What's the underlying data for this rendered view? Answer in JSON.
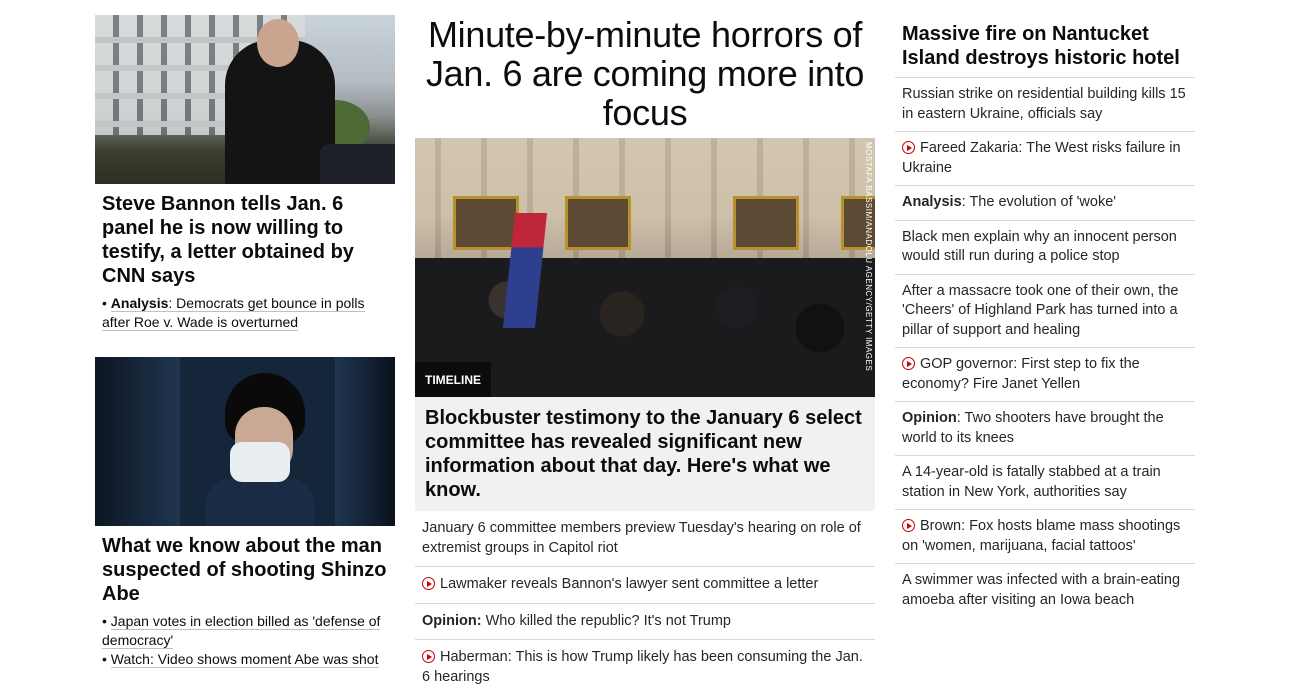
{
  "left": {
    "story1": {
      "headline": "Steve Bannon tells Jan. 6 panel he is now willing to testify, a letter obtained by CNN says",
      "links": [
        {
          "prefix": "Analysis",
          "text": ": Democrats get bounce in polls after Roe v. Wade is overturned"
        }
      ]
    },
    "story2": {
      "headline": "What we know about the man suspected of shooting Shinzo Abe",
      "links": [
        {
          "text": "Japan votes in election billed as 'defense of democracy'"
        },
        {
          "text": "Watch: Video shows moment Abe was shot"
        }
      ]
    }
  },
  "center": {
    "title": "Minute-by-minute horrors of Jan. 6 are coming more into focus",
    "photo_credit": "MOSTAFA BASSIM/ANADOLU AGENCY/GETTY IMAGES",
    "badge": "TIMELINE",
    "hero_text": "Blockbuster testimony to the January 6 select committee has revealed significant new information about that day. Here's what we know.",
    "items": [
      {
        "text": "January 6 committee members preview Tuesday's hearing on role of extremist groups in Capitol riot"
      },
      {
        "video": true,
        "text": "Lawmaker reveals Bannon's lawyer sent committee a letter"
      },
      {
        "prefix": "Opinion:",
        "text": " Who killed the republic? It's not Trump"
      },
      {
        "video": true,
        "text": "Haberman: This is how Trump likely has been consuming the Jan. 6 hearings"
      }
    ]
  },
  "right": {
    "headline": "Massive fire on Nantucket Island destroys historic hotel",
    "items": [
      {
        "text": "Russian strike on residential building kills 15 in eastern Ukraine, officials say"
      },
      {
        "video": true,
        "text": "Fareed Zakaria: The West risks failure in Ukraine"
      },
      {
        "prefix": "Analysis",
        "text": ": The evolution of 'woke'"
      },
      {
        "text": "Black men explain why an innocent person would still run during a police stop"
      },
      {
        "text": "After a massacre took one of their own, the 'Cheers' of Highland Park has turned into a pillar of support and healing"
      },
      {
        "video": true,
        "text": "GOP governor: First step to fix the economy? Fire Janet Yellen"
      },
      {
        "prefix": "Opinion",
        "text": ": Two shooters have brought the world to its knees"
      },
      {
        "text": "A 14-year-old is fatally stabbed at a train station in New York, authorities say"
      },
      {
        "video": true,
        "text": "Brown: Fox hosts blame mass shootings on 'women, marijuana, facial tattoos'"
      },
      {
        "text": "A swimmer was infected with a brain-eating amoeba after visiting an Iowa beach"
      }
    ]
  },
  "colors": {
    "accent_red": "#cc0000",
    "text": "#0c0c0c",
    "hero_bg": "#f1f1f1"
  }
}
